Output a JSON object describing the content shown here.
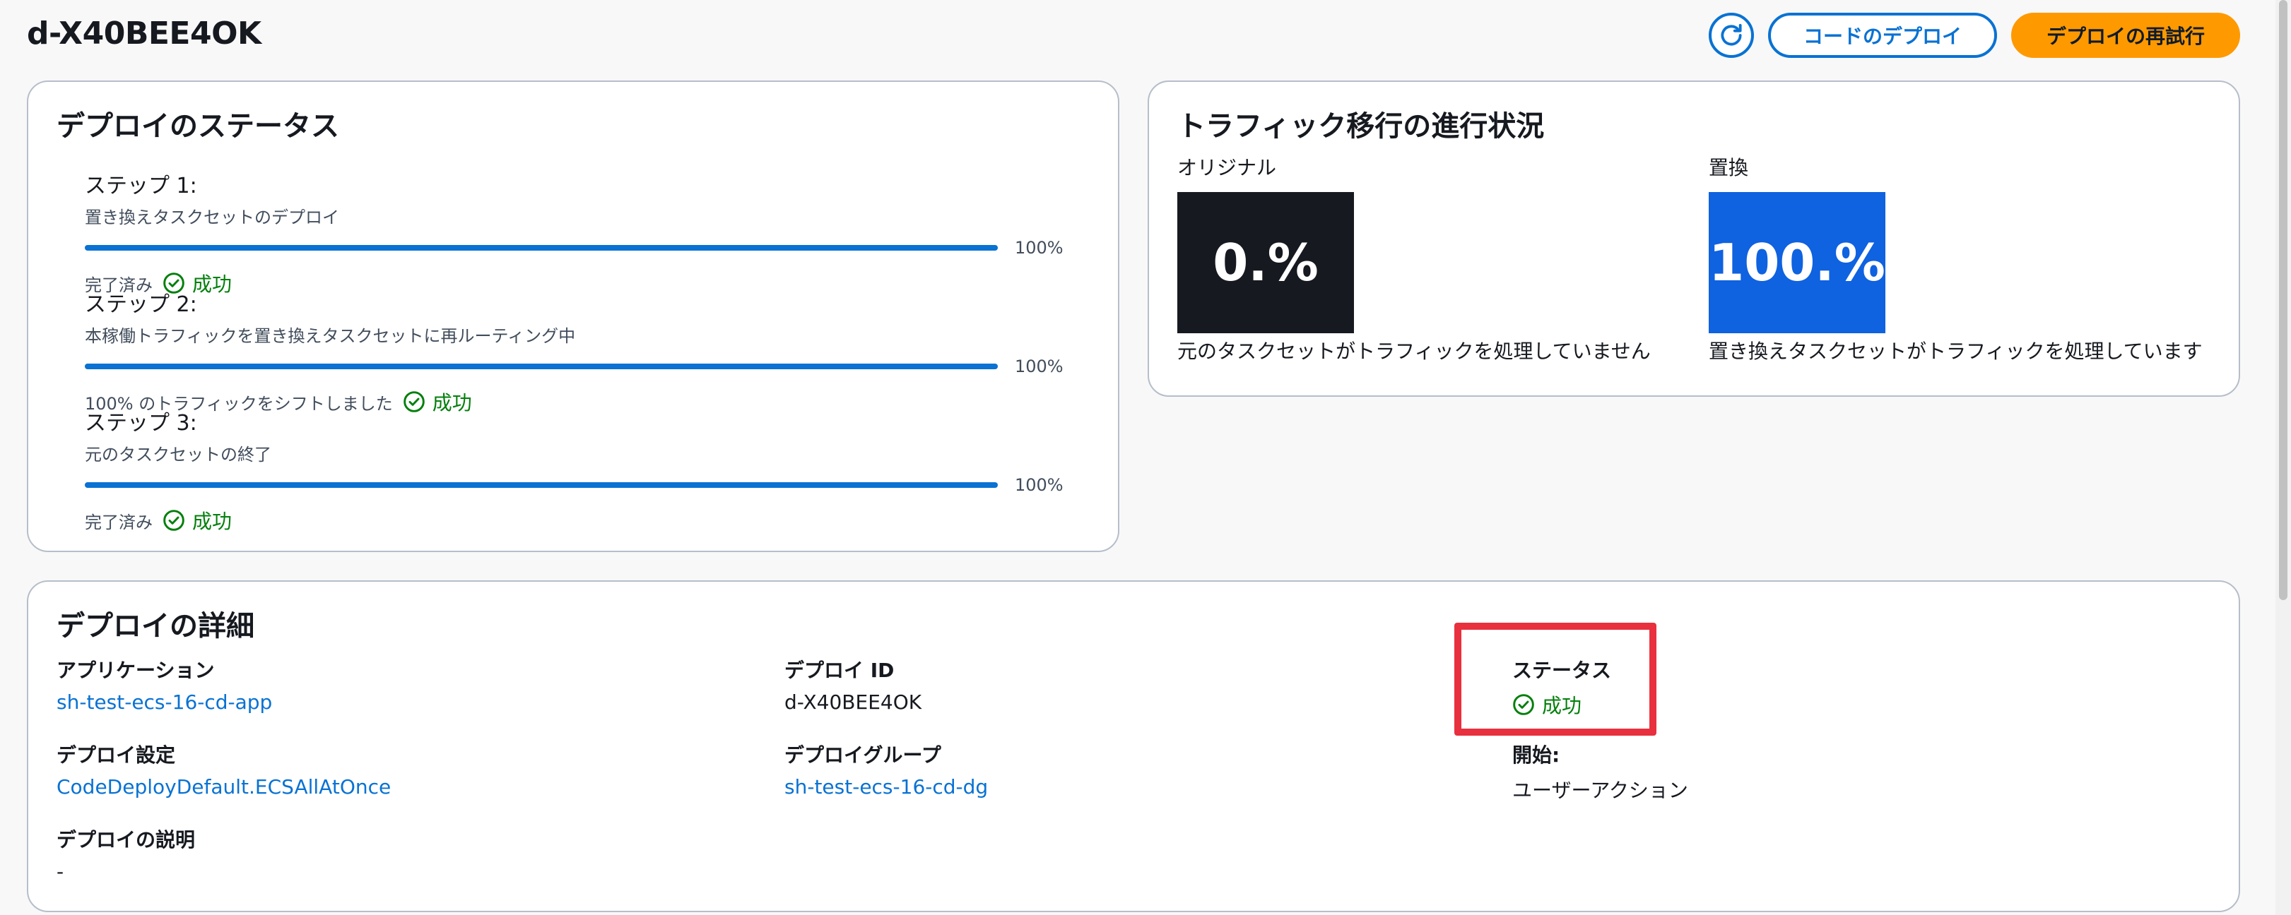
{
  "header": {
    "title": "d-X40BEE4OK",
    "code_deploy_button": "コードのデプロイ",
    "retry_button": "デプロイの再試行",
    "refresh_icon": "refresh-icon"
  },
  "status_panel": {
    "title": "デプロイのステータス",
    "steps": [
      {
        "title": "ステップ 1:",
        "subtitle": "置き換えタスクセットのデプロイ",
        "progress": 100,
        "progress_label": "100%",
        "status_text": "完了済み",
        "result": "成功"
      },
      {
        "title": "ステップ 2:",
        "subtitle": "本稼働トラフィックを置き換えタスクセットに再ルーティング中",
        "progress": 100,
        "progress_label": "100%",
        "status_text": "100% のトラフィックをシフトしました",
        "result": "成功"
      },
      {
        "title": "ステップ 3:",
        "subtitle": "元のタスクセットの終了",
        "progress": 100,
        "progress_label": "100%",
        "status_text": "完了済み",
        "result": "成功"
      }
    ]
  },
  "traffic_panel": {
    "title": "トラフィック移行の進行状況",
    "original": {
      "label": "オリジナル",
      "value": "0.%",
      "description": "元のタスクセットがトラフィックを処理していません",
      "color": "#16191f"
    },
    "replacement": {
      "label": "置換",
      "value": "100.%",
      "description": "置き換えタスクセットがトラフィックを処理しています",
      "color": "#0f62e0"
    }
  },
  "details_panel": {
    "title": "デプロイの詳細",
    "application": {
      "label": "アプリケーション",
      "value": "sh-test-ecs-16-cd-app"
    },
    "deployment_id": {
      "label": "デプロイ ID",
      "value": "d-X40BEE4OK"
    },
    "status": {
      "label": "ステータス",
      "value": "成功"
    },
    "deployment_config": {
      "label": "デプロイ設定",
      "value": "CodeDeployDefault.ECSAllAtOnce"
    },
    "deployment_group": {
      "label": "デプロイグループ",
      "value": "sh-test-ecs-16-cd-dg"
    },
    "initiated_by": {
      "label": "開始:",
      "value": "ユーザーアクション"
    },
    "description": {
      "label": "デプロイの説明",
      "value": "-"
    }
  },
  "colors": {
    "accent": "#0972d3",
    "primary_button": "#ff9900",
    "success": "#037f0c",
    "highlight": "#e8303e"
  }
}
